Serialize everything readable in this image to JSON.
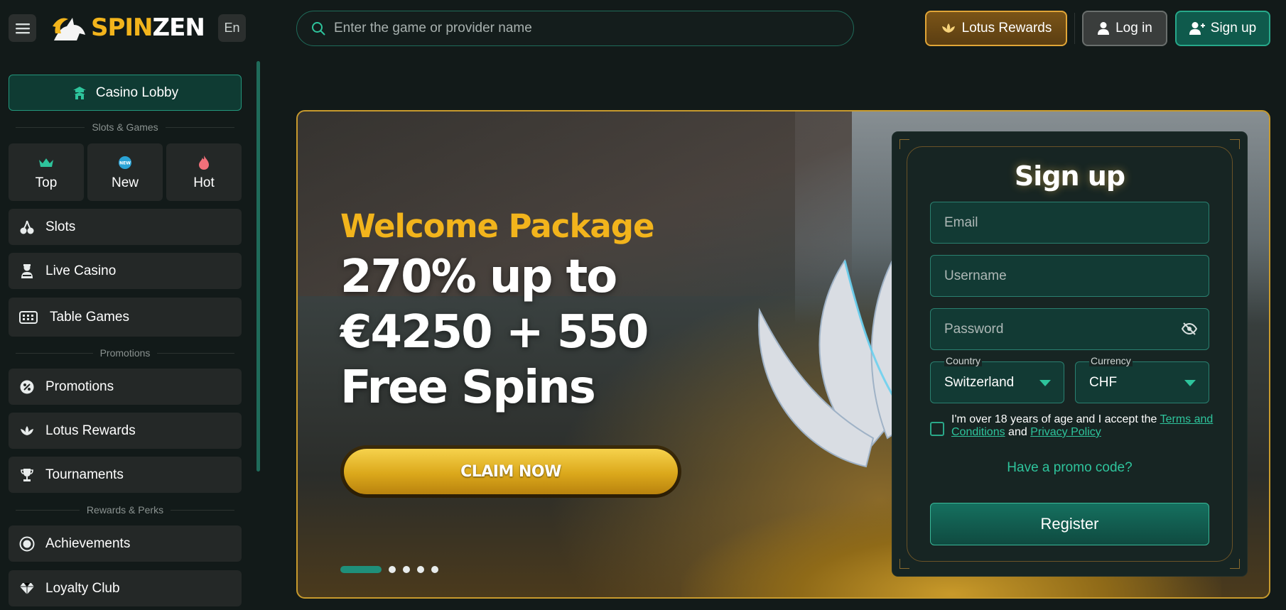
{
  "header": {
    "menu_icon": "hamburger-icon",
    "logo_part1": "SPIN",
    "logo_part2": "ZEN",
    "language": "En",
    "search_placeholder": "Enter the game or provider name",
    "lotus_rewards": "Lotus Rewards",
    "login": "Log in",
    "signup": "Sign up"
  },
  "sidebar": {
    "lobby": "Casino Lobby",
    "section_slots_games": "Slots & Games",
    "tiles": [
      {
        "label": "Top",
        "icon": "crown-icon"
      },
      {
        "label": "New",
        "icon": "new-badge-icon"
      },
      {
        "label": "Hot",
        "icon": "flame-icon"
      }
    ],
    "items_games": [
      {
        "label": "Slots",
        "icon": "cherries-icon"
      },
      {
        "label": "Live Casino",
        "icon": "dealer-icon"
      },
      {
        "label": "Table Games",
        "icon": "cards-table-icon"
      }
    ],
    "section_promotions": "Promotions",
    "items_promotions": [
      {
        "label": "Promotions",
        "icon": "percent-badge-icon"
      },
      {
        "label": "Lotus Rewards",
        "icon": "lotus-icon"
      },
      {
        "label": "Tournaments",
        "icon": "trophy-icon"
      }
    ],
    "section_rewards": "Rewards & Perks",
    "items_rewards": [
      {
        "label": "Achievements",
        "icon": "medal-icon"
      },
      {
        "label": "Loyalty Club",
        "icon": "diamond-icon"
      }
    ]
  },
  "hero": {
    "kicker": "Welcome Package",
    "offer": "270% up to €4250 + 550 Free Spins",
    "cta": "CLAIM NOW",
    "slides_total": 5,
    "active_slide": 1
  },
  "signup_form": {
    "title": "Sign up",
    "email_placeholder": "Email",
    "username_placeholder": "Username",
    "password_placeholder": "Password",
    "country_label": "Country",
    "country_value": "Switzerland",
    "currency_label": "Currency",
    "currency_value": "CHF",
    "agree_prefix": "I'm over 18 years of age and I accept the ",
    "terms_link": "Terms and Conditions",
    "agree_middle": " and ",
    "privacy_link": "Privacy Policy",
    "promo_link": "Have a promo code?",
    "register": "Register"
  },
  "colors": {
    "background": "#121a19",
    "accent_teal": "#2ec49c",
    "accent_gold": "#f2b41c"
  }
}
